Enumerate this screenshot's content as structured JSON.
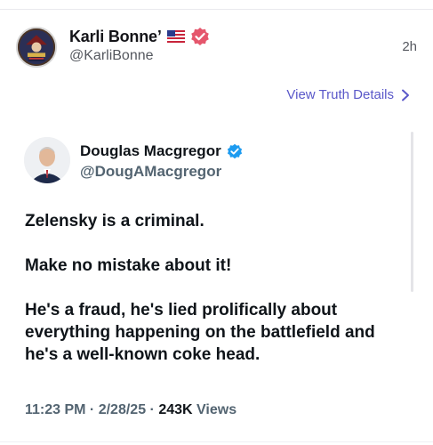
{
  "post": {
    "author_name": "Karli Bonne’",
    "author_handle": "@KarliBonne",
    "timestamp": "2h",
    "details_link": "View Truth Details",
    "flag_icon": "us-flag-icon",
    "badge_icon": "verified-badge-icon",
    "badge_color": "#e5566c"
  },
  "quoted": {
    "name": "Douglas Macgregor",
    "handle": "@DougAMacgregor",
    "verified_color": "#1d9bf0",
    "paragraphs": [
      "Zelensky is a criminal.",
      "Make no mistake about it!",
      "He's a fraud, he's lied prolifically about everything happening on the battlefield and he's a well-known coke head."
    ],
    "time": "11:23 PM",
    "date": "2/28/25",
    "views_count": "243K",
    "views_label": "Views"
  },
  "colors": {
    "accent": "#5a58c9",
    "text": "#0f1419",
    "muted": "#536471"
  }
}
